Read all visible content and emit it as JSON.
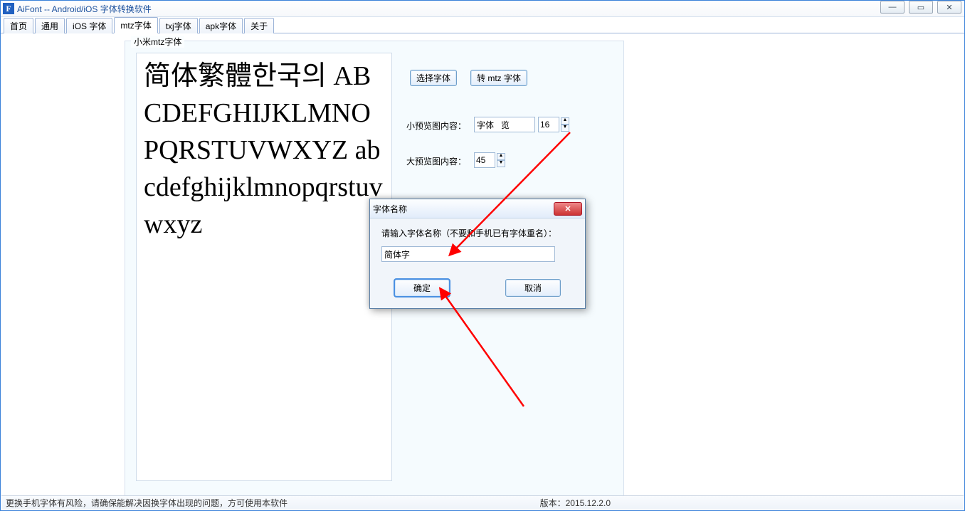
{
  "window": {
    "title": "AiFont -- Android/iOS 字体转换软件",
    "icon_letter": "F",
    "controls": {
      "min": "—",
      "max": "▭",
      "close": "✕"
    }
  },
  "tabs": [
    {
      "label": "首页"
    },
    {
      "label": "通用"
    },
    {
      "label": "iOS 字体"
    },
    {
      "label": "mtz字体",
      "active": true
    },
    {
      "label": "txj字体"
    },
    {
      "label": "apk字体"
    },
    {
      "label": "关于"
    }
  ],
  "group": {
    "legend": "小米mtz字体",
    "preview_text": "简体繁體한국의\nABCDEFGHIJKLMNOPQRSTUVWXYZ\nabcdefghijklmnopqrstuvwxyz",
    "select_font_btn": "选择字体",
    "convert_btn": "转 mtz 字体",
    "small_preview_label": "小预览图内容：",
    "small_preview_value": "字体   览",
    "small_preview_size": "16",
    "big_preview_label": "大预览图内容：",
    "big_preview_size": "45"
  },
  "dialog": {
    "title": "字体名称",
    "prompt": "请输入字体名称（不要和手机已有字体重名）：",
    "input_value": "简体字",
    "ok": "确定",
    "cancel": "取消"
  },
  "status": {
    "message": "更换手机字体有风险，请确保能解决因换字体出现的问题，方可使用本软件",
    "version": "版本：2015.12.2.0"
  }
}
